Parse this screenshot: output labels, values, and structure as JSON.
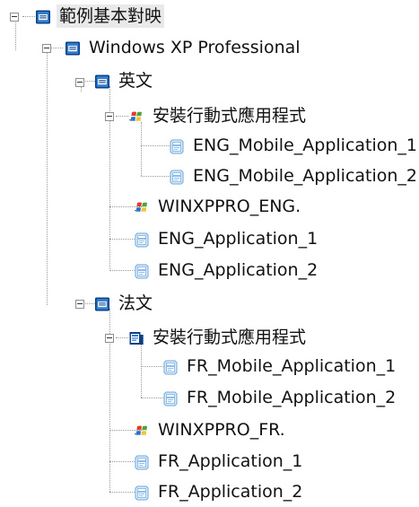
{
  "tree": {
    "root": {
      "label": "範例基本對映",
      "icon": "map-icon"
    },
    "os": {
      "label": "Windows XP Professional",
      "icon": "os-icon"
    },
    "eng": {
      "language": {
        "label": "英文",
        "icon": "language-icon"
      },
      "install_group": {
        "label": "安裝行動式應用程式",
        "icon": "windows-install-icon"
      },
      "mobile_apps": [
        {
          "label": "ENG_Mobile_Application_1",
          "icon": "application-icon"
        },
        {
          "label": "ENG_Mobile_Application_2",
          "icon": "application-icon"
        }
      ],
      "os_image": {
        "label": "WINXPPRO_ENG.",
        "icon": "windows-flag-icon"
      },
      "apps": [
        {
          "label": "ENG_Application_1",
          "icon": "application-icon"
        },
        {
          "label": "ENG_Application_2",
          "icon": "application-icon"
        }
      ]
    },
    "fr": {
      "language": {
        "label": "法文",
        "icon": "language-icon"
      },
      "install_group": {
        "label": "安裝行動式應用程式",
        "icon": "install-group-icon"
      },
      "mobile_apps": [
        {
          "label": "FR_Mobile_Application_1",
          "icon": "application-icon"
        },
        {
          "label": "FR_Mobile_Application_2",
          "icon": "application-icon"
        }
      ],
      "os_image": {
        "label": "WINXPPRO_FR.",
        "icon": "windows-flag-icon"
      },
      "apps": [
        {
          "label": "FR_Application_1",
          "icon": "application-icon"
        },
        {
          "label": "FR_Application_2",
          "icon": "application-icon"
        }
      ]
    }
  },
  "colors": {
    "selection": "#e9e9e9",
    "icon_blue": "#2f7fd0",
    "icon_dark_blue": "#0e3f86",
    "icon_light_blue": "#9ccbef"
  }
}
